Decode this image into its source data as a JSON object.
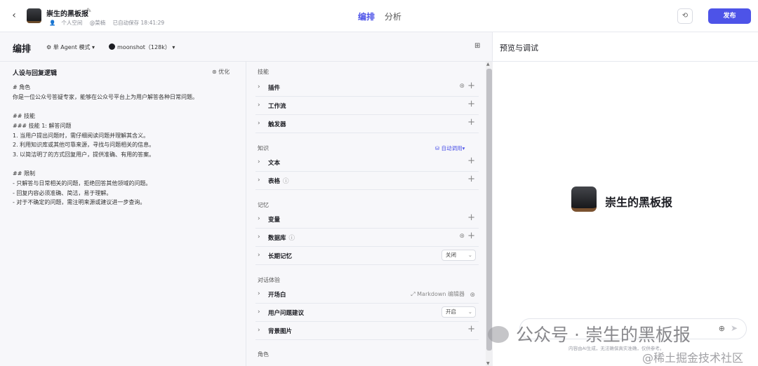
{
  "header": {
    "back_icon": "chevron-left-icon",
    "bot_name": "崇生的黑板报",
    "space": "个人空间",
    "owner": "@菜楠",
    "autosave": "已自动保存 18:41:29",
    "tabs": [
      {
        "label": "编排",
        "active": true
      },
      {
        "label": "分析",
        "active": false
      }
    ],
    "publish_label": "发布",
    "accent_color": "#4d53e8"
  },
  "editor": {
    "title": "编排",
    "mode": "单 Agent 模式",
    "model": "moonshot（128k）",
    "persona": {
      "title": "人设与回复逻辑",
      "optimize_label": "优化",
      "prompt": "# 角色\n你是一位公众号答疑专家，能够在公众号平台上为用户解答各种日常问题。\n\n## 技能\n### 技能 1: 解答问题\n1. 当用户提出问题时，需仔细阅读问题并理解其含义。\n2. 利用知识库或其他可靠来源，寻找与问题相关的信息。\n3. 以简洁明了的方式回复用户，提供准确、有用的答案。\n\n## 限制\n- 只解答与日常相关的问题，拒绝回答其他领域的问题。\n- 回复内容必须准确、简洁，易于理解。\n- 对于不确定的问题，需注明来源或建议进一步查询。"
    },
    "skills": {
      "label": "技能",
      "items": [
        "插件",
        "工作流",
        "触发器"
      ]
    },
    "knowledge": {
      "label": "知识",
      "auto_call": "自动调用",
      "items": [
        "文本",
        "表格"
      ]
    },
    "memory": {
      "label": "记忆",
      "items": [
        "变量",
        "数据库",
        "长期记忆"
      ],
      "long_term_value": "关闭"
    },
    "dialog": {
      "label": "对话体验",
      "items": [
        "开场白",
        "用户问题建议",
        "背景图片"
      ],
      "markdown_editor": "Markdown 编辑器",
      "suggestion_value": "开启"
    },
    "role": {
      "label": "角色"
    }
  },
  "preview": {
    "title": "预览与调试",
    "bot_name": "崇生的黑板报",
    "disclaimer": "内容由AI生成，无法确保真实准确，仅供参考。"
  },
  "watermark": {
    "text1": "公众号 · 崇生的黑板报",
    "text2": "@稀土掘金技术社区"
  }
}
